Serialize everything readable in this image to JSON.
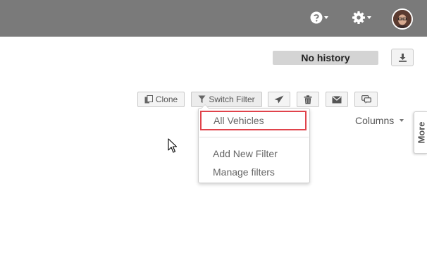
{
  "header": {
    "help_icon": "question-circle-icon",
    "settings_icon": "gear-icon",
    "avatar": "user-avatar"
  },
  "toolbar": {
    "history_label": "No history",
    "download_icon": "download-icon",
    "clone_label": "Clone",
    "switch_filter_label": "Switch Filter",
    "send_icon": "paper-plane-icon",
    "delete_icon": "trash-icon",
    "email_icon": "envelope-icon",
    "comment_icon": "comments-icon"
  },
  "columns_label": "Columns",
  "more_tab_label": "More",
  "filter_menu": {
    "items": [
      {
        "label": "All Vehicles",
        "highlighted": true
      },
      {
        "label": "Add New Filter"
      },
      {
        "label": "Manage filters"
      }
    ]
  },
  "colors": {
    "header_bg": "#7a7a7a",
    "highlight_border": "#e0434b"
  }
}
